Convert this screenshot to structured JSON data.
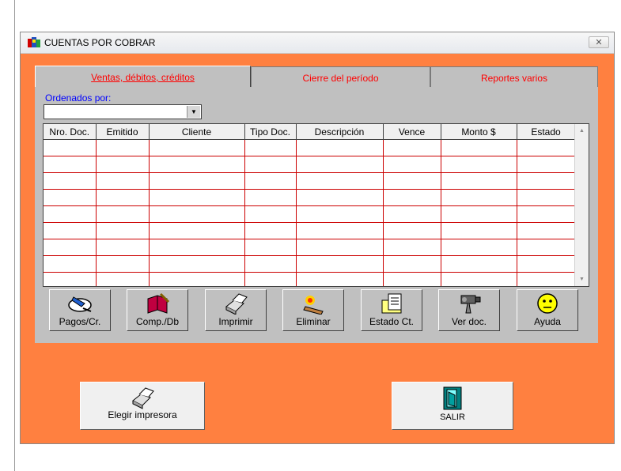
{
  "window": {
    "title": "CUENTAS POR COBRAR",
    "close_label": "✕"
  },
  "tabs": [
    {
      "label": "Ventas, débitos, créditos"
    },
    {
      "label": "Cierre del período"
    },
    {
      "label": "Reportes varios"
    }
  ],
  "order": {
    "label": "Ordenados por:",
    "value": ""
  },
  "table": {
    "columns": [
      "Nro. Doc.",
      "Emitido",
      "Cliente",
      "Tipo Doc.",
      "Descripción",
      "Vence",
      "Monto  $",
      "Estado"
    ]
  },
  "toolbar": [
    {
      "label": "Pagos/Cr.",
      "icon": "payments-icon"
    },
    {
      "label": "Comp./Db",
      "icon": "purchase-book-icon"
    },
    {
      "label": "Imprimir",
      "icon": "printer-icon"
    },
    {
      "label": "Eliminar",
      "icon": "eraser-icon"
    },
    {
      "label": "Estado Ct.",
      "icon": "folder-document-icon"
    },
    {
      "label": "Ver doc.",
      "icon": "camera-icon"
    },
    {
      "label": "Ayuda",
      "icon": "smiley-icon"
    }
  ],
  "printer_button": {
    "label": "Elegir impresora"
  },
  "exit_button": {
    "label": "SALIR"
  }
}
